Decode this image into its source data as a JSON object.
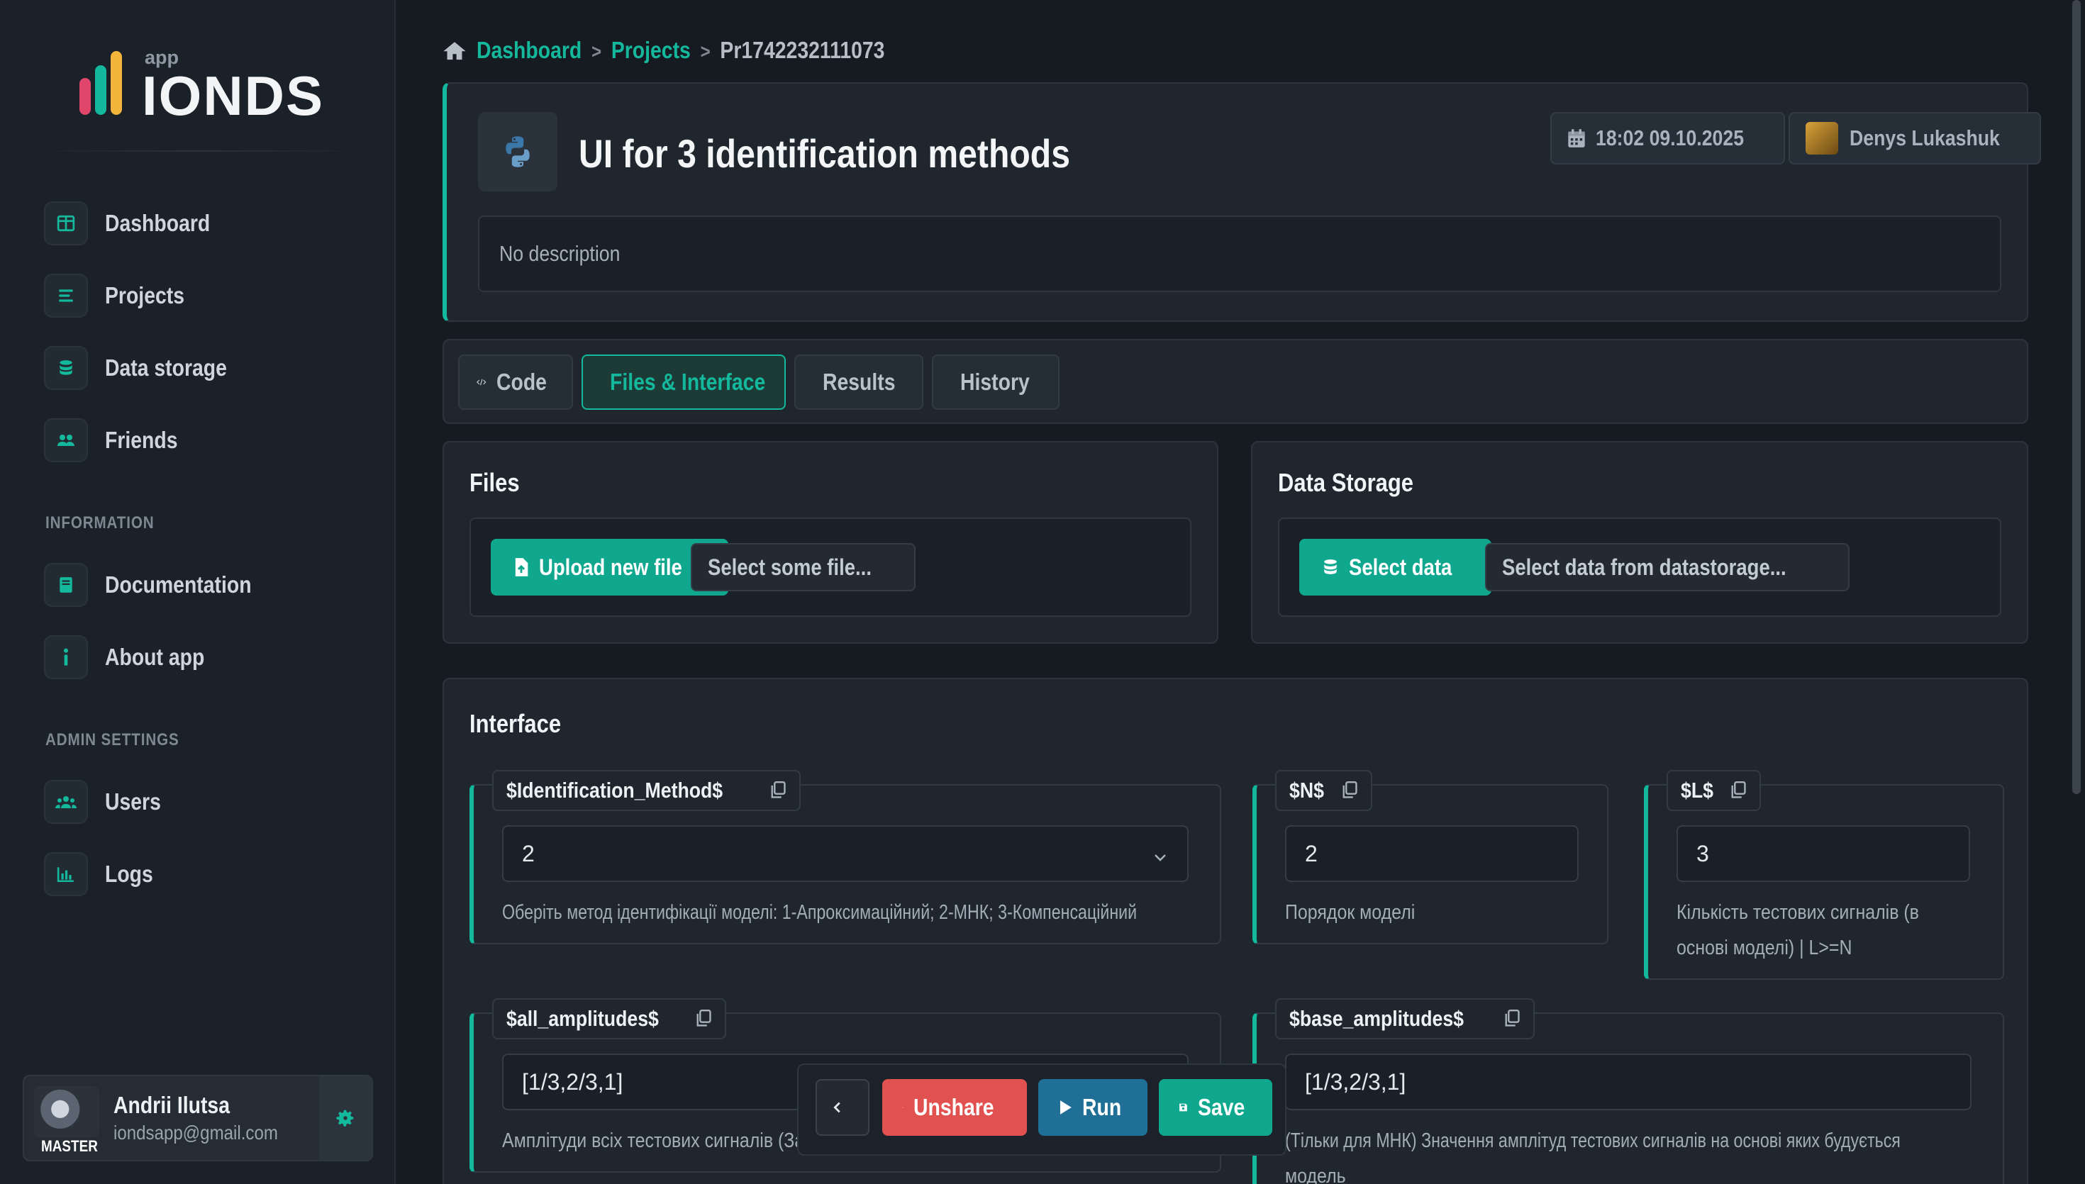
{
  "app": {
    "logo_small": "app",
    "logo_main": "IONDS"
  },
  "sidebar": {
    "items": [
      {
        "label": "Dashboard"
      },
      {
        "label": "Projects"
      },
      {
        "label": "Data storage"
      },
      {
        "label": "Friends"
      }
    ],
    "info_title": "INFORMATION",
    "info_items": [
      {
        "label": "Documentation"
      },
      {
        "label": "About app"
      }
    ],
    "admin_title": "ADMIN SETTINGS",
    "admin_items": [
      {
        "label": "Users"
      },
      {
        "label": "Logs"
      }
    ],
    "user": {
      "name": "Andrii Ilutsa",
      "email": "iondsapp@gmail.com",
      "badge": "MASTER"
    }
  },
  "breadcrumb": {
    "home": "Dashboard",
    "projects": "Projects",
    "current": "Pr1742232111073"
  },
  "project": {
    "title": "UI for 3 identification methods",
    "datetime": "18:02 09.10.2025",
    "owner": "Denys Lukashuk",
    "description": "No description"
  },
  "tabs": [
    {
      "label": "Code"
    },
    {
      "label": "Files & Interface"
    },
    {
      "label": "Results"
    },
    {
      "label": "History"
    }
  ],
  "files": {
    "title": "Files",
    "upload_label": "Upload new file",
    "select_label": "Select some file..."
  },
  "storage": {
    "title": "Data Storage",
    "select_label": "Select data",
    "select_from_label": "Select data from datastorage..."
  },
  "interface": {
    "title": "Interface",
    "params": [
      {
        "name": "$Identification_Method$",
        "value": "2",
        "help": "Оберіть метод ідентифікації моделі: 1-Апроксимаційний; 2-МНК; 3-Компенсаційний"
      },
      {
        "name": "$N$",
        "value": "2",
        "help": "Порядок моделі"
      },
      {
        "name": "$L$",
        "value": "3",
        "help_1": "Кількість тестових сигналів (в",
        "help_2": "основі моделі) | L>=N"
      },
      {
        "name": "$all_amplitudes$",
        "value": "[1/3,2/3,1]",
        "help": "Амплітуди всіх тестових сигналів (За"
      },
      {
        "name": "$base_amplitudes$",
        "value": "[1/3,2/3,1]",
        "help_1": "(Тільки для МНК) Значення амплітуд тестових сигналів на основі яких будується",
        "help_2": "модель"
      }
    ]
  },
  "actions": {
    "unshare": "Unshare",
    "run": "Run",
    "save": "Save"
  },
  "colors": {
    "accent": "#14b89c",
    "danger": "#e0514f",
    "run": "#1f6f97",
    "save": "#0fa88f"
  }
}
